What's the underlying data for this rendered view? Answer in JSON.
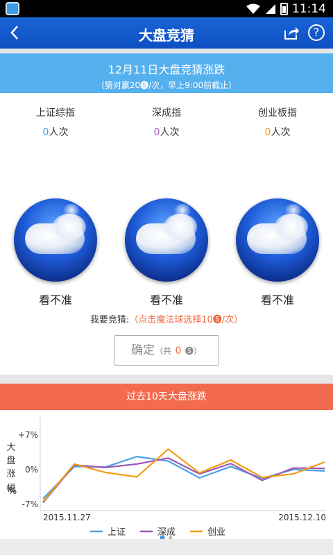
{
  "status_bar": {
    "time": "11:14"
  },
  "app_bar": {
    "title": "大盘竞猜"
  },
  "banner": {
    "title": "12月11日大盘竞猜涨跌",
    "subtitle": "（猜对赢20🅢/次，早上9:00前截止）"
  },
  "indices": [
    {
      "name": "上证综指",
      "count": "0",
      "unit": "人次",
      "color": "#3d9be8"
    },
    {
      "name": "深成指",
      "count": "0",
      "unit": "人次",
      "color": "#9b59b6"
    },
    {
      "name": "创业板指",
      "count": "0",
      "unit": "人次",
      "color": "#f39c12"
    }
  ],
  "balls": [
    {
      "label": "看不准"
    },
    {
      "label": "看不准"
    },
    {
      "label": "看不准"
    }
  ],
  "prompt": {
    "label": "我要竞猜:",
    "hint": "（点击魔法球选择10🅢/次）"
  },
  "confirm": {
    "label": "确定",
    "total_prefix": "（共",
    "total": "0",
    "total_suffix": "🅢）"
  },
  "chart_header": "过去10天大盘涨跌",
  "chart_data": {
    "type": "line",
    "ylabel": "大盘涨幅%",
    "yticks": [
      "+7%",
      "0%",
      "-7%"
    ],
    "ylim": [
      -7,
      7
    ],
    "x_start_label": "2015.11.27",
    "x_end_label": "2015.12.10",
    "x": [
      1,
      2,
      3,
      4,
      5,
      6,
      7,
      8,
      9,
      10
    ],
    "series": [
      {
        "name": "上证",
        "color": "#4a9fe0",
        "values": [
          -6.0,
          0.5,
          0.4,
          2.5,
          1.6,
          -1.8,
          0.5,
          -1.9,
          -0.1,
          -0.4
        ]
      },
      {
        "name": "深成",
        "color": "#9b59b6",
        "values": [
          -6.8,
          0.8,
          0.3,
          1.0,
          2.2,
          -1.0,
          1.1,
          -2.3,
          0.2,
          0.1
        ]
      },
      {
        "name": "创业",
        "color": "#f39c12",
        "values": [
          -6.6,
          1.0,
          -0.7,
          -1.6,
          4.0,
          -0.8,
          1.8,
          -1.7,
          -1.0,
          1.4
        ]
      }
    ]
  }
}
